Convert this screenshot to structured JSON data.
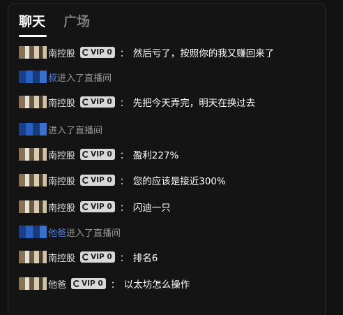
{
  "tabs": {
    "chat": "聊天",
    "plaza": "广场"
  },
  "vip_label": "VIP 0",
  "colon": "：",
  "system_text": "进入了直播间",
  "messages": [
    {
      "name": "南控股",
      "text": "然后亏了，按照你的我又赚回来了"
    },
    {
      "name": "叔"
    },
    {
      "name": "南控股",
      "text": "先把今天弄完，明天在换过去"
    },
    {
      "name": ""
    },
    {
      "name": "南控股",
      "text": "盈利227%"
    },
    {
      "name": "南控股",
      "text": "您的应该是接近300%"
    },
    {
      "name": "南控股",
      "text": "闪迪一只"
    },
    {
      "name": "他爸"
    },
    {
      "name": "南控股",
      "text": "排名6"
    },
    {
      "name": "他爸",
      "text": "以太坊怎么操作"
    }
  ]
}
